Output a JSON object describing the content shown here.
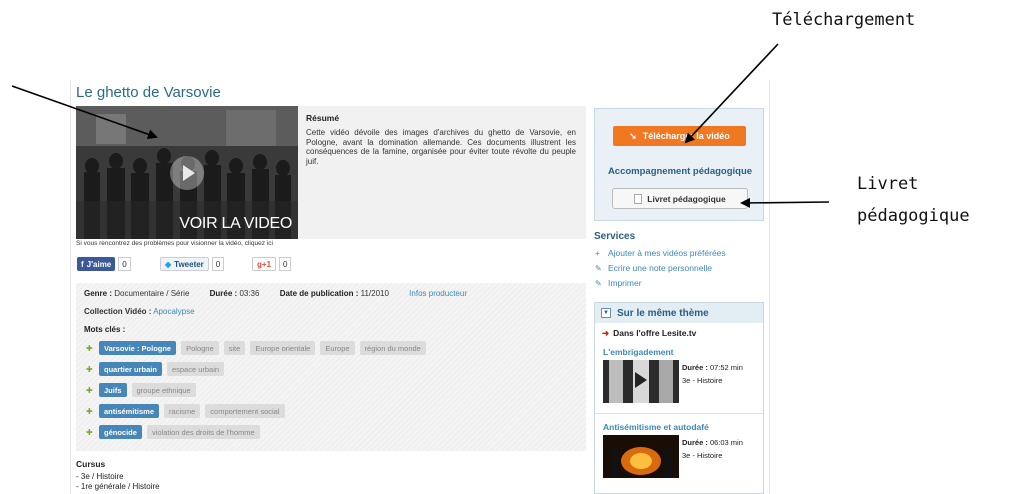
{
  "annotations": {
    "telechargement": "Téléchargement",
    "livret_line1": "Livret",
    "livret_line2": "pédagogique"
  },
  "page": {
    "title": "Le ghetto de Varsovie"
  },
  "video": {
    "overlay_label": "VOIR LA VIDEO",
    "help_text": "Si vous rencontrez des problèmes pour visionner la vidéo, cliquez ici"
  },
  "resume": {
    "heading": "Résumé",
    "text": "Cette vidéo dévoile des images d'archives du ghetto de Varsovie, en Pologne, avant la domination allemande. Ces documents illustrent les conséquences de la famine, organisée pour éviter toute révolte du peuple juif."
  },
  "social": {
    "facebook_label": "J'aime",
    "facebook_count": "0",
    "twitter_label": "Tweeter",
    "twitter_count": "0",
    "gplus_label": "+1",
    "gplus_count": "0"
  },
  "meta": {
    "genre_label": "Genre :",
    "genre_value": "Documentaire / Série",
    "duree_label": "Durée :",
    "duree_value": "03:36",
    "date_label": "Date de publication :",
    "date_value": "11/2010",
    "infos_link": "Infos producteur",
    "collection_label": "Collection Vidéo :",
    "collection_value": "Apocalypse",
    "keywords_label": "Mots clés :",
    "tag_rows": [
      {
        "primary": "Varsovie : Pologne",
        "secondary": [
          "Pologne",
          "site",
          "Europe orientale",
          "Europe",
          "région du monde"
        ]
      },
      {
        "primary": "quartier urbain",
        "secondary": [
          "espace urbain"
        ]
      },
      {
        "primary": "Juifs",
        "secondary": [
          "groupe ethnique"
        ]
      },
      {
        "primary": "antisémitisme",
        "secondary": [
          "racisme",
          "comportement social"
        ]
      },
      {
        "primary": "génocide",
        "secondary": [
          "violation des droits de l'homme"
        ]
      }
    ]
  },
  "cursus": {
    "title": "Cursus",
    "items": [
      "- 3e / Histoire",
      "- 1re générale / Histoire"
    ]
  },
  "sidebar": {
    "download_button": "Télécharger la vidéo",
    "accompagnement_title": "Accompagnement pédagogique",
    "livret_button": "Livret pédagogique",
    "services_title": "Services",
    "services": [
      {
        "icon": "plus-icon",
        "glyph": "+",
        "label": "Ajouter à mes vidéos préférées"
      },
      {
        "icon": "note-icon",
        "glyph": "✎",
        "label": "Ecrire une note personnelle"
      },
      {
        "icon": "print-icon",
        "glyph": "✎",
        "label": "Imprimer"
      }
    ],
    "theme": {
      "title": "Sur le même thème",
      "offre": "Dans l'offre Lesite.tv",
      "videos": [
        {
          "title": "L'embrigadement",
          "duree_label": "Durée :",
          "duree_value": "07:52 min",
          "level": "3e - Histoire"
        },
        {
          "title": "Antisémitisme et autodafé",
          "duree_label": "Durée :",
          "duree_value": "06:03 min",
          "level": "3e - Histoire"
        }
      ]
    }
  },
  "colors": {
    "accent_blue": "#2a5e85",
    "link_blue": "#3d88b8",
    "download_orange": "#f07820",
    "tag_blue": "#4786b8"
  }
}
